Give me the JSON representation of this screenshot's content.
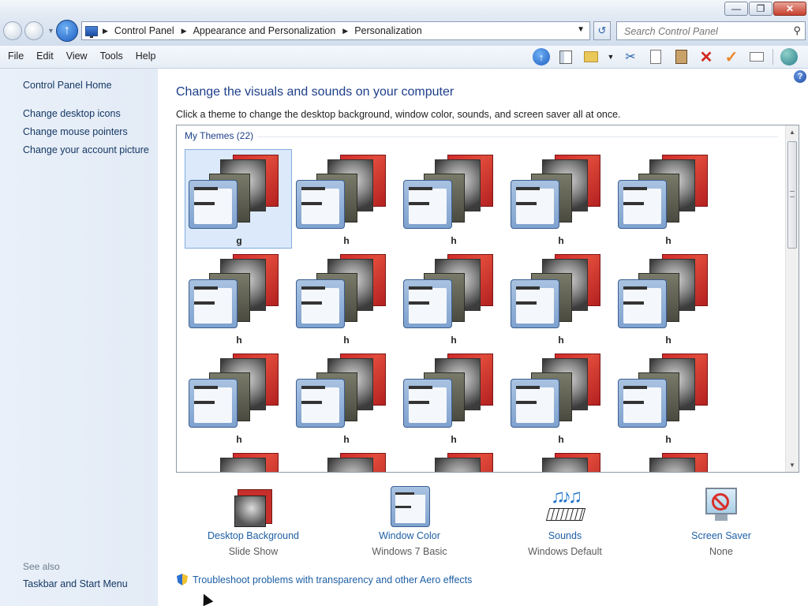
{
  "window": {
    "minimize_icon": "minimize-icon",
    "maximize_icon": "restore-icon",
    "close_icon": "close-icon"
  },
  "address": {
    "crumbs": [
      "Control Panel",
      "Appearance and Personalization",
      "Personalization"
    ],
    "search_placeholder": "Search Control Panel"
  },
  "menu": {
    "items": [
      "File",
      "Edit",
      "View",
      "Tools",
      "Help"
    ]
  },
  "toolbar": {
    "icons": [
      "up-icon",
      "pane-icon",
      "folder-icon",
      "cut-icon",
      "copy-icon",
      "paste-icon",
      "delete-icon",
      "check-icon",
      "mail-icon",
      "globe-icon"
    ]
  },
  "sidebar": {
    "home": "Control Panel Home",
    "links": [
      "Change desktop icons",
      "Change mouse pointers",
      "Change your account picture"
    ],
    "see_also": "See also",
    "see_also_links": [
      "Taskbar and Start Menu"
    ]
  },
  "main": {
    "title": "Change the visuals and sounds on your computer",
    "description": "Click a theme to change the desktop background, window color, sounds, and screen saver all at once.",
    "group_header": "My Themes (22)",
    "themes": [
      "g",
      "h",
      "h",
      "h",
      "h",
      "h",
      "h",
      "h",
      "h",
      "h",
      "h",
      "h",
      "h",
      "h",
      "h",
      "",
      "",
      "",
      "",
      ""
    ],
    "selected_theme_index": 0
  },
  "settings": [
    {
      "label": "Desktop Background",
      "value": "Slide Show",
      "icon": "desktop-background-icon"
    },
    {
      "label": "Window Color",
      "value": "Windows 7 Basic",
      "icon": "window-color-icon"
    },
    {
      "label": "Sounds",
      "value": "Windows Default",
      "icon": "sounds-icon"
    },
    {
      "label": "Screen Saver",
      "value": "None",
      "icon": "screen-saver-icon"
    }
  ],
  "troubleshoot_link": "Troubleshoot problems with transparency and other Aero effects",
  "colors": {
    "link": "#1e5fa5",
    "title": "#1e3f8a",
    "sidebar_bg": "#e9f0f9",
    "selection": "#dbe9fb"
  }
}
